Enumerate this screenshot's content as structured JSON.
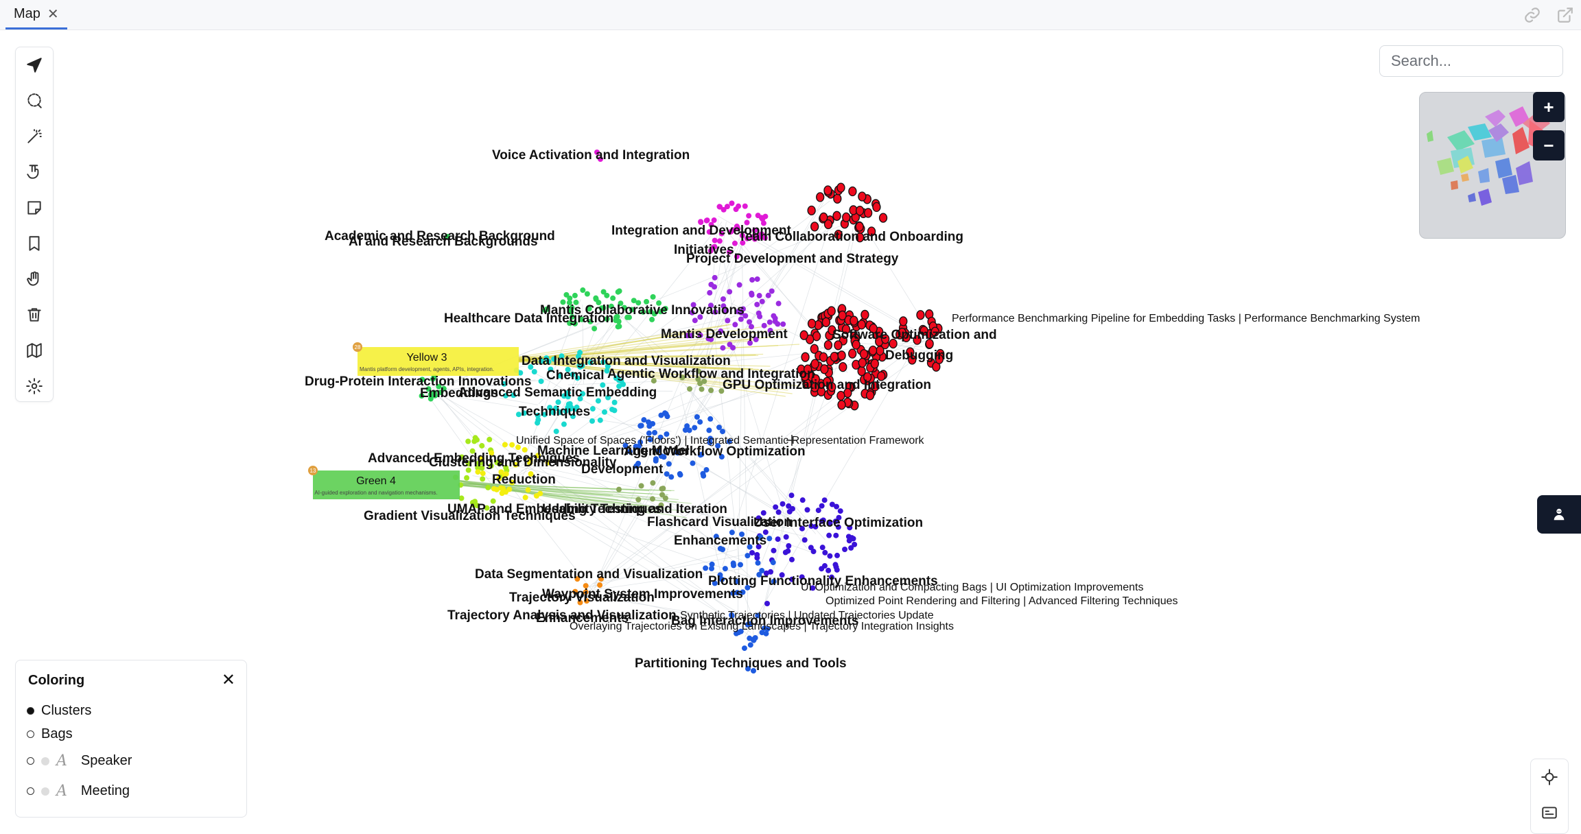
{
  "tab": {
    "title": "Map",
    "close": "✕"
  },
  "search": {
    "placeholder": "Search..."
  },
  "zoom": {
    "in": "+",
    "out": "−"
  },
  "coloring": {
    "title": "Coloring",
    "close": "✕",
    "options": [
      {
        "label": "Clusters",
        "selected": true
      },
      {
        "label": "Bags",
        "selected": false
      },
      {
        "label": "Speaker",
        "selected": false
      },
      {
        "label": "Meeting",
        "selected": false
      }
    ]
  },
  "toolbar_icons": [
    "navigate-icon",
    "lasso-select-icon",
    "magic-wand-icon",
    "pointer-hand-icon",
    "sticky-note-icon",
    "bookmark-icon",
    "pan-hand-icon",
    "trash-icon",
    "map-icon",
    "settings-icon"
  ],
  "notes": [
    {
      "title": "Yellow 3",
      "subtitle": "Mantis platform development, agents, APIs, integration.",
      "badge": "28",
      "color": "#f5f03a"
    },
    {
      "title": "Green 4",
      "subtitle": "AI-guided exploration and navigation mechanisms.",
      "badge": "13",
      "color": "#5fcf55"
    }
  ],
  "cluster_labels": [
    "Voice Activation and Integration",
    "Academic and Research Background",
    "AI and Research Backgrounds",
    "Integration and Development",
    "Initiatives",
    "Team Collaboration and Onboarding",
    "Project Development and Strategy",
    "Mantis Collaborative Innovations",
    "Healthcare Data Integration",
    "Mantis Development",
    "Software Optimization and",
    "Debugging",
    "Data Integration and Visualization",
    "Chemical",
    "Agentic Workflow and Integration",
    "Drug-Protein Interaction Innovations",
    "GPU Optimization and Integration",
    "Embeddings",
    "Advanced Semantic Embedding",
    "Techniques",
    "Machine Learning Model",
    "Agent Workflow Optimization",
    "Advanced Embedding Techniques",
    "Clustering and Dimensionality",
    "Development",
    "Reduction",
    "UMAP and Embedding Techniques",
    "Usability Testing and Iteration",
    "Gradient Visualization Techniques",
    "Flashcard Visualization",
    "User Interface Optimization",
    "Enhancements",
    "Data Segmentation and Visualization",
    "Plotting Functionality Enhancements",
    "Waypoint System Improvements",
    "Trajectory Visualization",
    "Trajectory Analysis and Visualization",
    "Enhancements",
    "Bag Interaction Improvements",
    "Partitioning Techniques and Tools"
  ],
  "item_labels": [
    "Performance Benchmarking Pipeline for Embedding Tasks | Performance Benchmarking System",
    "Unified Space of Spaces ('Floors') | Integrated Semantic Representation Framework",
    "UI Optimization and Compacting Bags | UI Optimization Improvements",
    "Optimized Point Rendering and Filtering | Advanced Filtering Techniques",
    "Synthetic Trajectories | Updated Trajectories Update",
    "Overlaying Trajectories on Existing Landscapes | Trajectory Integration Insights"
  ],
  "colors": {
    "accent": "#3b6fd8",
    "dark_button": "#121a2b",
    "magenta": "#e01ad6",
    "purple": "#9a2be0",
    "red": "#ee0a1e",
    "green": "#2fd35a",
    "teal": "#19d9cf",
    "blue": "#1e5be0",
    "indigo": "#3a12d8",
    "lime": "#a6e81c",
    "yellow": "#f3ee10",
    "orange": "#f58b14",
    "olive": "#8aa65a"
  }
}
